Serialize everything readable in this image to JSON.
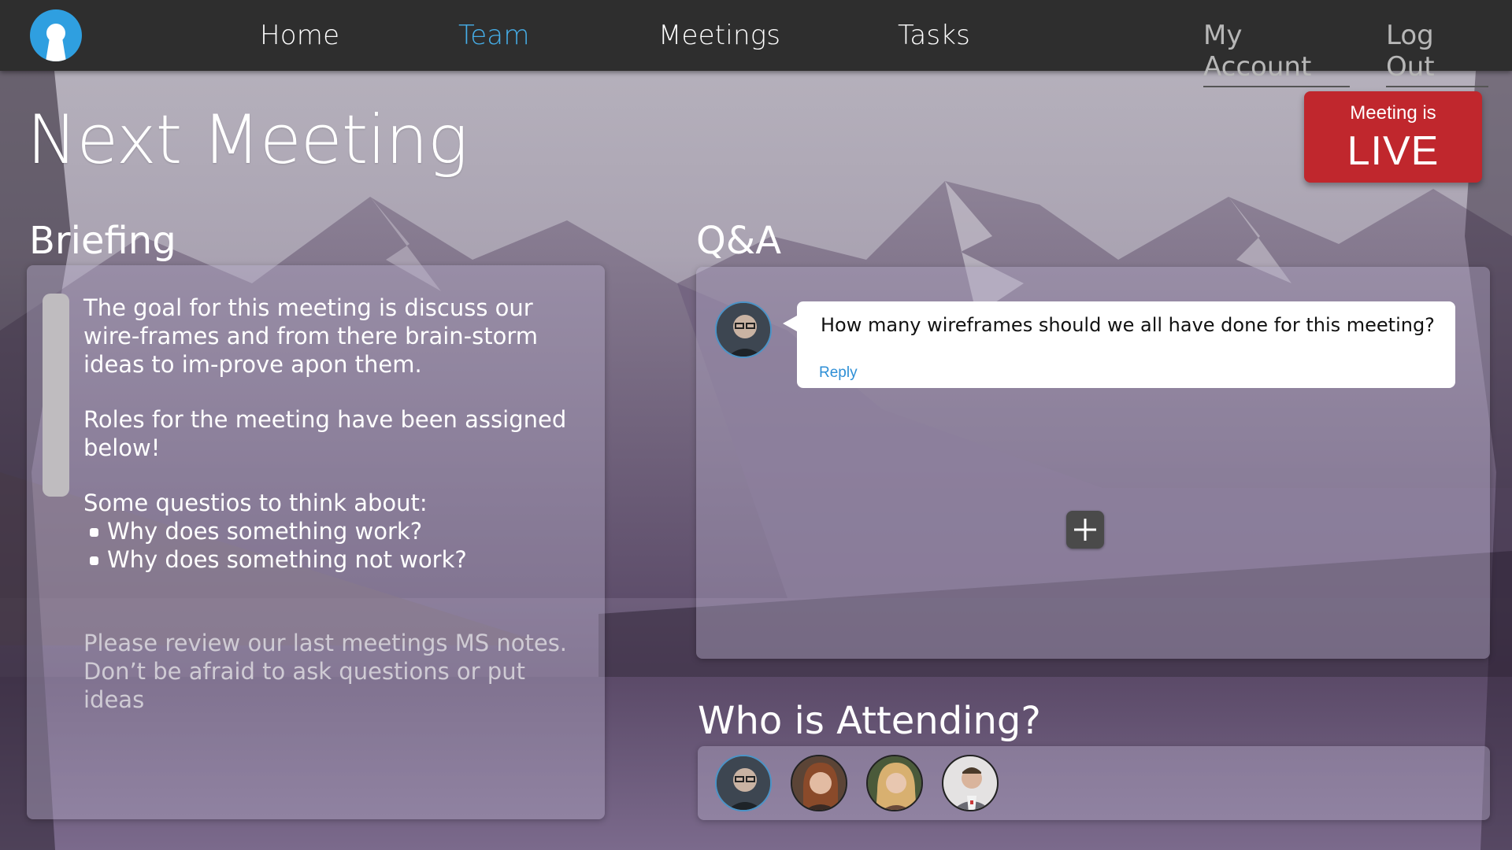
{
  "nav": {
    "logo_icon": "keyhole-logo-icon",
    "links": [
      {
        "label": "Home",
        "active": false
      },
      {
        "label": "Team",
        "active": true
      },
      {
        "label": "Meetings",
        "active": false
      },
      {
        "label": "Tasks",
        "active": false
      }
    ],
    "account": {
      "my_account": "My Account",
      "log_out": "Log Out"
    }
  },
  "page": {
    "title": "Next Meeting"
  },
  "live_badge": {
    "line1": "Meeting is",
    "line2": "LIVE",
    "color": "#c0272d"
  },
  "briefing": {
    "heading": "Briefing",
    "paragraph1": "The goal for this meeting is discuss our wire-frames and from there brain-storm ideas to im-prove apon them.",
    "paragraph2": "Roles for the meeting have been assigned below!",
    "questions_intro": "Some questios to think about:",
    "questions": [
      "Why does something work?",
      "Why does something not work?"
    ],
    "note_line1": "Please review our last meetings MS notes.",
    "note_line2": "Don’t be afraid to ask questions or put ideas"
  },
  "qa": {
    "heading": "Q&A",
    "question_text": "How many wireframes should we all have done for this meeting?",
    "reply_label": "Reply",
    "add_icon": "plus-icon"
  },
  "attending": {
    "heading": "Who is Attending?",
    "people": [
      {
        "avatar_icon": "man-glasses-avatar",
        "highlighted": true
      },
      {
        "avatar_icon": "woman-red-hair-avatar",
        "highlighted": false
      },
      {
        "avatar_icon": "woman-blonde-avatar",
        "highlighted": false
      },
      {
        "avatar_icon": "man-blazer-avatar",
        "highlighted": false
      }
    ]
  },
  "colors": {
    "accent_blue": "#46aee8",
    "navbar": "#2e2e2e",
    "live_red": "#c0272d",
    "reply_link": "#2e8fd6"
  }
}
